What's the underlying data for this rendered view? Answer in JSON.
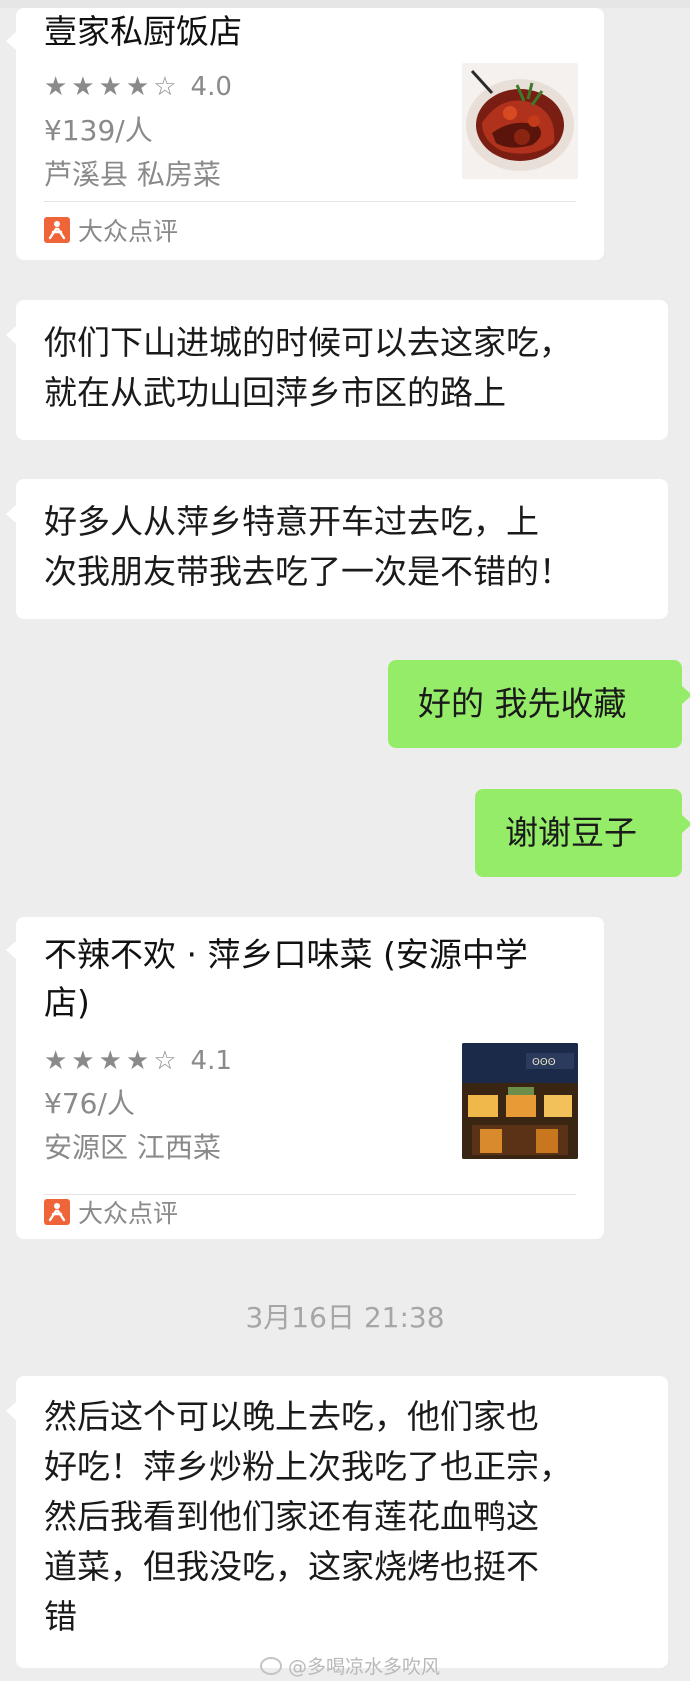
{
  "restaurant_cards": [
    {
      "name": "壹家私厨饭店",
      "stars": "★★★★☆",
      "score": "4.0",
      "price": "¥139/人",
      "location": "芦溪县 私房菜",
      "source": "大众点评",
      "thumbnail_icon": "food-photo-icon"
    },
    {
      "name": "不辣不欢 · 萍乡口味菜 (安源中学店)",
      "stars": "★★★★☆",
      "score": "4.1",
      "price": "¥76/人",
      "location": "安源区 江西菜",
      "source": "大众点评",
      "thumbnail_icon": "restaurant-front-photo-icon"
    }
  ],
  "messages": [
    {
      "direction": "incoming",
      "lines": [
        "你们下山进城的时候可以去这家吃，",
        "就在从武功山回萍乡市区的路上"
      ]
    },
    {
      "direction": "incoming",
      "lines": [
        "好多人从萍乡特意开车过去吃，上",
        "次我朋友带我去吃了一次是不错的！"
      ]
    },
    {
      "direction": "outgoing",
      "lines": [
        "好的 我先收藏"
      ]
    },
    {
      "direction": "outgoing",
      "lines": [
        "谢谢豆子"
      ]
    },
    {
      "direction": "incoming",
      "lines": [
        "然后这个可以晚上去吃，他们家也",
        "好吃！萍乡炒粉上次我吃了也正宗，",
        "然后我看到他们家还有莲花血鸭这",
        "道菜，但我没吃，这家烧烤也挺不",
        "错"
      ]
    }
  ],
  "timestamp": "3月16日 21:38",
  "watermark": "@多喝凉水多吹风",
  "colors": {
    "background": "#ededed",
    "incoming_bubble": "#ffffff",
    "outgoing_bubble": "#95ec69",
    "dianping_brand": "#f0643a"
  }
}
